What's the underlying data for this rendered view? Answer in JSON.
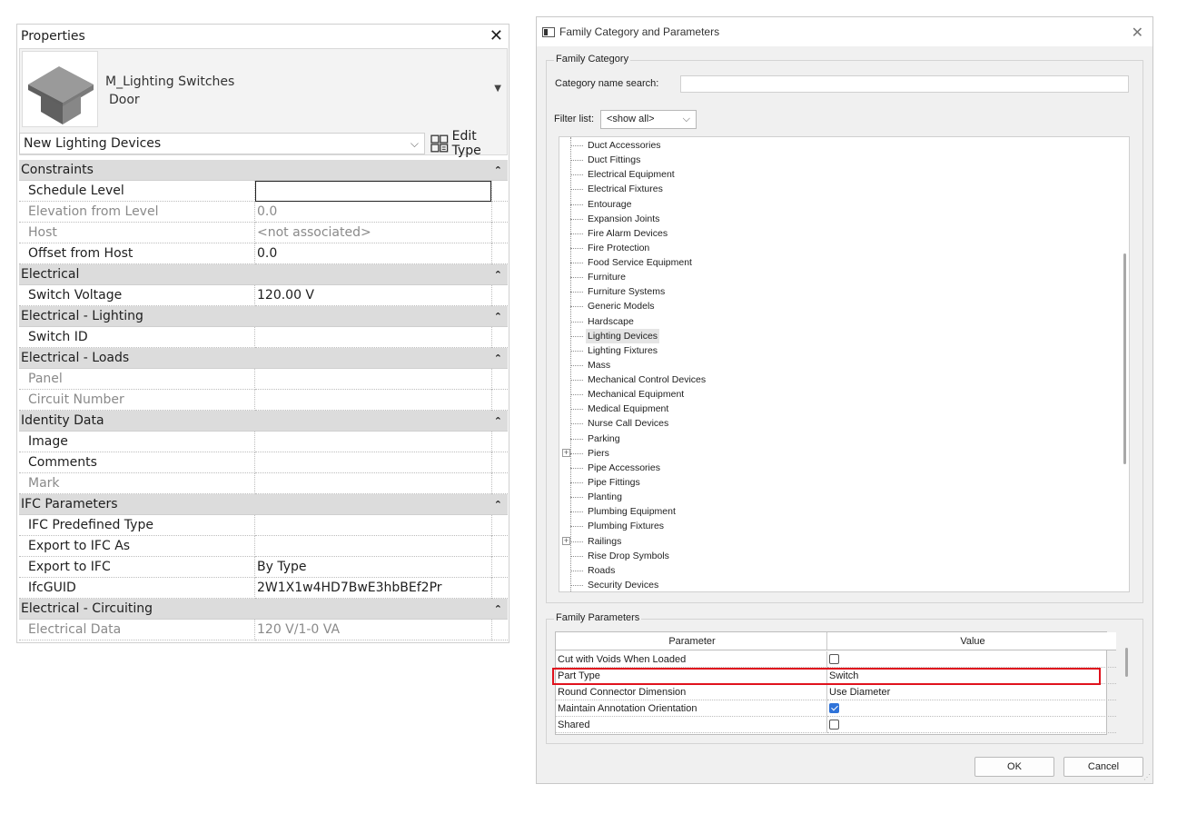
{
  "properties": {
    "title": "Properties",
    "family_name": "M_Lighting Switches",
    "family_type": "Door",
    "type_selector": "New Lighting Devices",
    "edit_type_label": "Edit Type",
    "groups": [
      {
        "name": "Constraints",
        "rows": [
          {
            "label": "Schedule Level",
            "value": "",
            "grey": false,
            "editing": true
          },
          {
            "label": "Elevation from Level",
            "value": "0.0",
            "grey": true
          },
          {
            "label": "Host",
            "value": "<not associated>",
            "grey": true
          },
          {
            "label": "Offset from Host",
            "value": "0.0",
            "grey": false
          }
        ]
      },
      {
        "name": "Electrical",
        "rows": [
          {
            "label": "Switch Voltage",
            "value": "120.00 V",
            "grey": false
          }
        ]
      },
      {
        "name": "Electrical - Lighting",
        "rows": [
          {
            "label": "Switch ID",
            "value": "",
            "grey": false
          }
        ]
      },
      {
        "name": "Electrical - Loads",
        "rows": [
          {
            "label": "Panel",
            "value": "",
            "grey": true
          },
          {
            "label": "Circuit Number",
            "value": "",
            "grey": true
          }
        ]
      },
      {
        "name": "Identity Data",
        "rows": [
          {
            "label": "Image",
            "value": "",
            "grey": false
          },
          {
            "label": "Comments",
            "value": "",
            "grey": false
          },
          {
            "label": "Mark",
            "value": "",
            "grey": true
          }
        ]
      },
      {
        "name": "IFC Parameters",
        "rows": [
          {
            "label": "IFC Predefined Type",
            "value": "",
            "grey": false
          },
          {
            "label": "Export to IFC As",
            "value": "",
            "grey": false
          },
          {
            "label": "Export to IFC",
            "value": "By Type",
            "grey": false
          },
          {
            "label": "IfcGUID",
            "value": "2W1X1w4HD7BwE3hbBEf2Pr",
            "grey": false
          }
        ]
      },
      {
        "name": "Electrical - Circuiting",
        "rows": [
          {
            "label": "Electrical Data",
            "value": "120 V/1-0 VA",
            "grey": true
          }
        ]
      }
    ]
  },
  "dialog": {
    "title": "Family Category and Parameters",
    "family_category_label": "Family Category",
    "search_label": "Category name search:",
    "search_value": "",
    "filter_label": "Filter list:",
    "filter_value": "<show all>",
    "categories": [
      {
        "name": "Duct Accessories",
        "expandable": false,
        "selected": false
      },
      {
        "name": "Duct Fittings",
        "expandable": false,
        "selected": false
      },
      {
        "name": "Electrical Equipment",
        "expandable": false,
        "selected": false
      },
      {
        "name": "Electrical Fixtures",
        "expandable": false,
        "selected": false
      },
      {
        "name": "Entourage",
        "expandable": false,
        "selected": false
      },
      {
        "name": "Expansion Joints",
        "expandable": false,
        "selected": false
      },
      {
        "name": "Fire Alarm Devices",
        "expandable": false,
        "selected": false
      },
      {
        "name": "Fire Protection",
        "expandable": false,
        "selected": false
      },
      {
        "name": "Food Service Equipment",
        "expandable": false,
        "selected": false
      },
      {
        "name": "Furniture",
        "expandable": false,
        "selected": false
      },
      {
        "name": "Furniture Systems",
        "expandable": false,
        "selected": false
      },
      {
        "name": "Generic Models",
        "expandable": false,
        "selected": false
      },
      {
        "name": "Hardscape",
        "expandable": false,
        "selected": false
      },
      {
        "name": "Lighting Devices",
        "expandable": false,
        "selected": true
      },
      {
        "name": "Lighting Fixtures",
        "expandable": false,
        "selected": false
      },
      {
        "name": "Mass",
        "expandable": false,
        "selected": false
      },
      {
        "name": "Mechanical Control Devices",
        "expandable": false,
        "selected": false
      },
      {
        "name": "Mechanical Equipment",
        "expandable": false,
        "selected": false
      },
      {
        "name": "Medical Equipment",
        "expandable": false,
        "selected": false
      },
      {
        "name": "Nurse Call Devices",
        "expandable": false,
        "selected": false
      },
      {
        "name": "Parking",
        "expandable": false,
        "selected": false
      },
      {
        "name": "Piers",
        "expandable": true,
        "selected": false
      },
      {
        "name": "Pipe Accessories",
        "expandable": false,
        "selected": false
      },
      {
        "name": "Pipe Fittings",
        "expandable": false,
        "selected": false
      },
      {
        "name": "Planting",
        "expandable": false,
        "selected": false
      },
      {
        "name": "Plumbing Equipment",
        "expandable": false,
        "selected": false
      },
      {
        "name": "Plumbing Fixtures",
        "expandable": false,
        "selected": false
      },
      {
        "name": "Railings",
        "expandable": true,
        "selected": false
      },
      {
        "name": "Rise Drop Symbols",
        "expandable": false,
        "selected": false
      },
      {
        "name": "Roads",
        "expandable": false,
        "selected": false
      },
      {
        "name": "Security Devices",
        "expandable": false,
        "selected": false
      }
    ],
    "family_parameters_label": "Family Parameters",
    "param_headers": {
      "parameter": "Parameter",
      "value": "Value"
    },
    "params": [
      {
        "name": "Cut with Voids When Loaded",
        "type": "checkbox",
        "checked": false
      },
      {
        "name": "Part Type",
        "type": "text",
        "value": "Switch"
      },
      {
        "name": "Round Connector Dimension",
        "type": "text",
        "value": "Use Diameter"
      },
      {
        "name": "Maintain Annotation Orientation",
        "type": "checkbox",
        "checked": true
      },
      {
        "name": "Shared",
        "type": "checkbox",
        "checked": false
      }
    ],
    "ok_label": "OK",
    "cancel_label": "Cancel",
    "highlight_color": "#e0121d",
    "accent_color": "#2f73d9"
  }
}
